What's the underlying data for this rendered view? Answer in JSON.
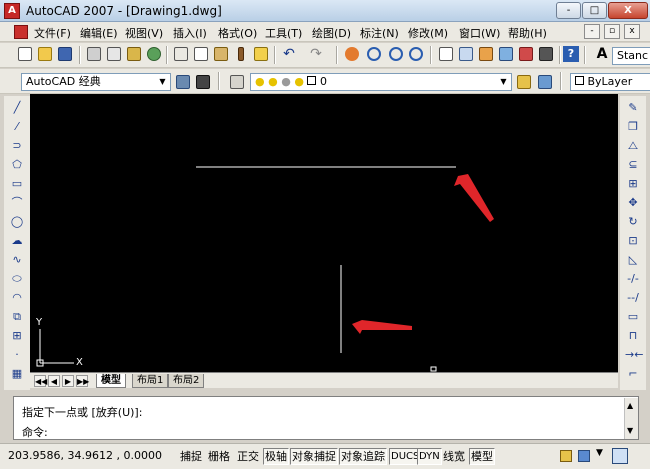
{
  "window": {
    "title": "AutoCAD 2007 - [Drawing1.dwg]",
    "controls": [
      "-",
      "□",
      "X"
    ],
    "mdi_controls": [
      "-",
      "▫",
      "x"
    ]
  },
  "menubar": {
    "items": [
      "文件(F)",
      "编辑(E)",
      "视图(V)",
      "插入(I)",
      "格式(O)",
      "工具(T)",
      "绘图(D)",
      "标注(N)",
      "修改(M)",
      "窗口(W)",
      "帮助(H)"
    ]
  },
  "standard_toolbar": {
    "style_combo": "Stanc"
  },
  "workspace_toolbar": {
    "workspace": "AutoCAD 经典",
    "layer": "0",
    "color": "ByLayer"
  },
  "layout_tabs": {
    "nav_buttons": [
      "◀◀",
      "◀",
      "▶",
      "▶▶"
    ],
    "tabs": [
      "模型",
      "布局1",
      "布局2"
    ],
    "active": "模型"
  },
  "drawing": {
    "ucs_x_label": "X",
    "ucs_y_label": "Y",
    "colors": {
      "background": "#000000",
      "lines": "#ffffff",
      "arrows": "#e0262a"
    }
  },
  "command": {
    "history": "指定下一点或 [放弃(U)]:",
    "prompt": "命令:",
    "scroll_up": "▲",
    "scroll_down": "▼"
  },
  "status": {
    "coordinates": "203.9586,  34.9612 , 0.0000",
    "toggles": [
      {
        "label": "捕捉",
        "on": false
      },
      {
        "label": "栅格",
        "on": false
      },
      {
        "label": "正交",
        "on": false
      },
      {
        "label": "极轴",
        "on": true
      },
      {
        "label": "对象捕捉",
        "on": true
      },
      {
        "label": "对象追踪",
        "on": true
      },
      {
        "label": "DUCS",
        "on": true
      },
      {
        "label": "DYN",
        "on": true
      },
      {
        "label": "线宽",
        "on": false
      },
      {
        "label": "模型",
        "on": true
      }
    ]
  },
  "icons": {
    "left_toolbar": [
      "line-icon",
      "construction-line-icon",
      "polyline-icon",
      "polygon-icon",
      "rectangle-icon",
      "arc-icon",
      "circle-icon",
      "revision-cloud-icon",
      "spline-icon",
      "ellipse-icon",
      "ellipse-arc-icon",
      "insert-block-icon",
      "make-block-icon",
      "point-icon",
      "hatch-icon"
    ],
    "right_toolbar": [
      "erase-icon",
      "copy-icon",
      "mirror-icon",
      "offset-icon",
      "array-icon",
      "move-icon",
      "rotate-icon",
      "scale-icon",
      "stretch-icon",
      "trim-icon",
      "extend-icon",
      "break-icon",
      "join-icon",
      "chamfer-icon",
      "fillet-icon"
    ]
  }
}
